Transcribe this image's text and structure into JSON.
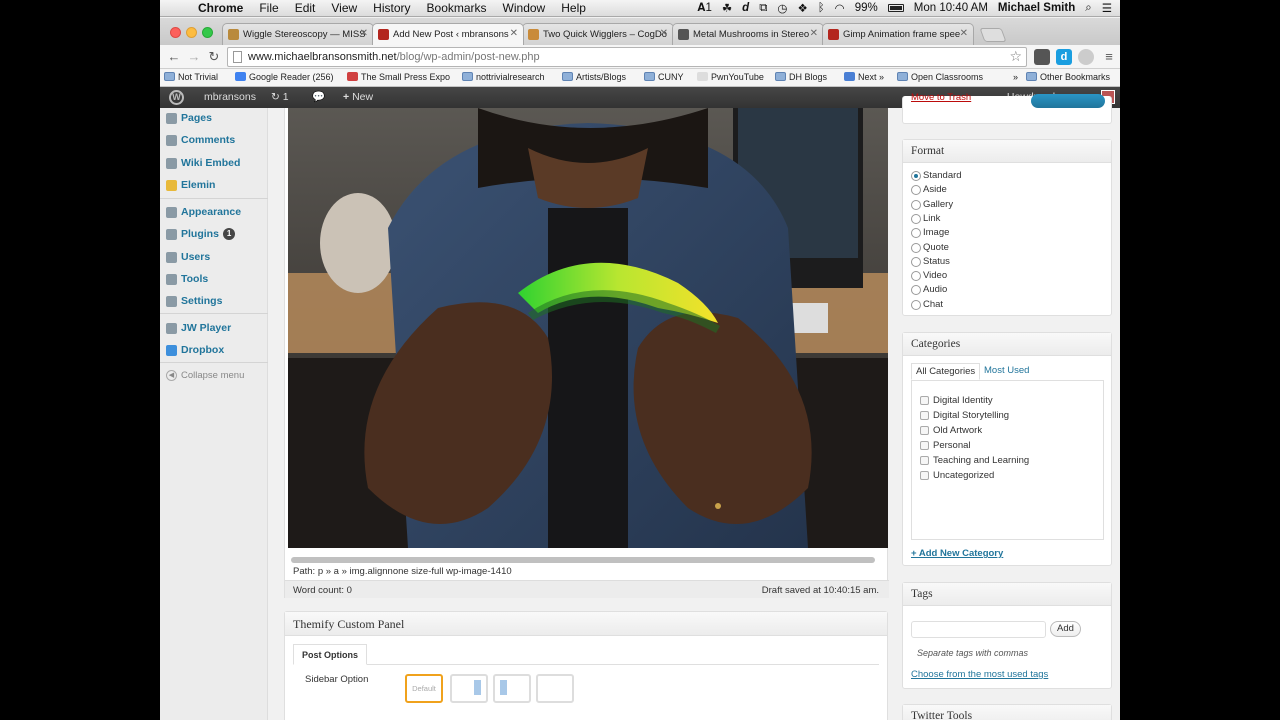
{
  "menubar": {
    "app": "Chrome",
    "items": [
      "File",
      "Edit",
      "View",
      "History",
      "Bookmarks",
      "Window",
      "Help"
    ],
    "adobe_count": "1",
    "battery": "99%",
    "clock": "Mon 10:40 AM",
    "user": "Michael Smith"
  },
  "tabs": [
    {
      "title": "Wiggle Stereoscopy — MISS",
      "color": "#b98a3c"
    },
    {
      "title": "Add New Post ‹ mbransons",
      "color": "#b3261e"
    },
    {
      "title": "Two Quick Wigglers – CogDo",
      "color": "#c98b3a"
    },
    {
      "title": "Metal Mushrooms in Stereo",
      "color": "#555555"
    },
    {
      "title": "Gimp Animation frame spee",
      "color": "#b3261e"
    }
  ],
  "address": {
    "host": "www.michaelbransonsmith.net",
    "path": "/blog/wp-admin/post-new.php"
  },
  "bookmarks": [
    {
      "label": "Not Trivial",
      "kind": "folder"
    },
    {
      "label": "Google Reader (256)",
      "kind": "site",
      "color": "#3f82f0"
    },
    {
      "label": "The Small Press Expo",
      "kind": "site",
      "color": "#d04040"
    },
    {
      "label": "nottrivialresearch",
      "kind": "folder"
    },
    {
      "label": "Artists/Blogs",
      "kind": "folder"
    },
    {
      "label": "CUNY",
      "kind": "folder"
    },
    {
      "label": "PwnYouTube",
      "kind": "site",
      "color": "#dddddd"
    },
    {
      "label": "DH Blogs",
      "kind": "folder"
    },
    {
      "label": "Next »",
      "kind": "site",
      "color": "#4a7fd4"
    },
    {
      "label": "Open Classrooms",
      "kind": "folder"
    },
    {
      "label": "»",
      "kind": "text"
    },
    {
      "label": "Other Bookmarks",
      "kind": "folder"
    }
  ],
  "adminbar": {
    "logo": "W",
    "site": "mbransons",
    "updates": "1",
    "new": "New",
    "howdy": "Howdy, mbransons"
  },
  "sidebar": {
    "items": [
      {
        "label": "Pages",
        "badge": ""
      },
      {
        "label": "Comments",
        "badge": ""
      },
      {
        "label": "Wiki Embed",
        "badge": ""
      },
      {
        "label": "Elemin",
        "badge": ""
      },
      {
        "label": "Appearance",
        "badge": ""
      },
      {
        "label": "Plugins",
        "badge": "1"
      },
      {
        "label": "Users",
        "badge": ""
      },
      {
        "label": "Tools",
        "badge": ""
      },
      {
        "label": "Settings",
        "badge": ""
      },
      {
        "label": "JW Player",
        "badge": ""
      },
      {
        "label": "Dropbox",
        "badge": ""
      }
    ],
    "collapse": "Collapse menu"
  },
  "editor": {
    "path_label": "Path:",
    "path_value": "p » a » img.alignnone size-full wp-image-1410",
    "word_count": "Word count: 0",
    "draft_saved": "Draft saved at 10:40:15 am."
  },
  "themify": {
    "title": "Themify Custom Panel",
    "tab": "Post Options",
    "sidebar_option": "Sidebar Option",
    "default_label": "Default"
  },
  "publish": {
    "trash": "Move to Trash"
  },
  "format": {
    "title": "Format",
    "options": [
      "Standard",
      "Aside",
      "Gallery",
      "Link",
      "Image",
      "Quote",
      "Status",
      "Video",
      "Audio",
      "Chat"
    ],
    "selected": "Standard"
  },
  "categories": {
    "title": "Categories",
    "tab_all": "All Categories",
    "tab_used": "Most Used",
    "items": [
      "Digital Identity",
      "Digital Storytelling",
      "Old Artwork",
      "Personal",
      "Teaching and Learning",
      "Uncategorized"
    ],
    "add_new": "+ Add New Category"
  },
  "tags": {
    "title": "Tags",
    "add": "Add",
    "hint": "Separate tags with commas",
    "choose": "Choose from the most used tags"
  },
  "next_box": {
    "title": "Twitter Tools"
  }
}
